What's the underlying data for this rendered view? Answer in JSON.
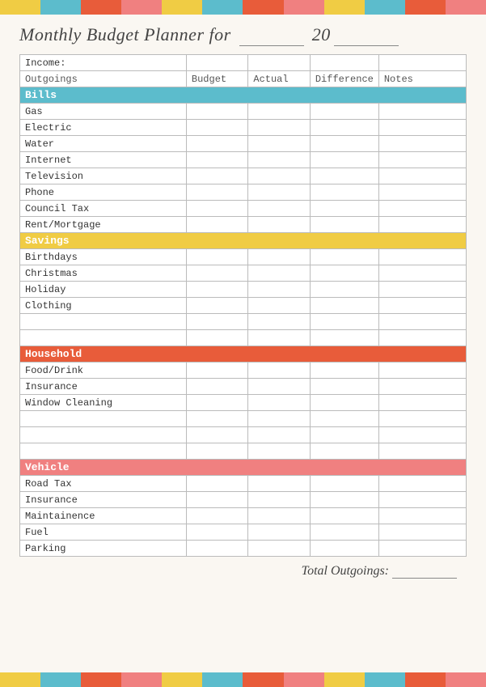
{
  "page": {
    "title_prefix": "Monthly Budget Planner for ",
    "title_line": "________",
    "title_year_prefix": " 20",
    "title_year": "__",
    "total_label": "Total Outgoings:",
    "total_value": "______"
  },
  "colors": {
    "strip": [
      "#f0cc44",
      "#5cbccc",
      "#e85c3a",
      "#f08080",
      "#f0cc44",
      "#5cbccc",
      "#e85c3a",
      "#f08080",
      "#f0cc44",
      "#5cbccc",
      "#e85c3a",
      "#f08080"
    ],
    "bills": "#5cbccc",
    "savings": "#f0cc44",
    "household": "#e85c3a",
    "vehicle": "#f08080"
  },
  "table": {
    "income_label": "Income:",
    "headers": {
      "outgoings": "Outgoings",
      "budget": "Budget",
      "actual": "Actual",
      "difference": "Difference",
      "notes": "Notes"
    },
    "sections": [
      {
        "name": "Bills",
        "type": "bills",
        "items": [
          "Gas",
          "Electric",
          "Water",
          "Internet",
          "Television",
          "Phone",
          "Council Tax",
          "Rent/Mortgage"
        ]
      },
      {
        "name": "Savings",
        "type": "savings",
        "items": [
          "Birthdays",
          "Christmas",
          "Holiday",
          "Clothing",
          "",
          ""
        ]
      },
      {
        "name": "Household",
        "type": "household",
        "items": [
          "Food/Drink",
          "Insurance",
          "Window Cleaning",
          "",
          "",
          ""
        ]
      },
      {
        "name": "Vehicle",
        "type": "vehicle",
        "items": [
          "Road Tax",
          "Insurance",
          "Maintainence",
          "Fuel",
          "Parking"
        ]
      }
    ]
  }
}
